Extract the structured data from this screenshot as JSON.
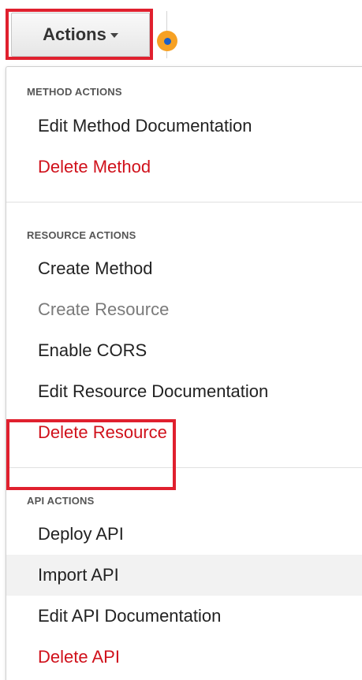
{
  "toolbar": {
    "actions_label": "Actions"
  },
  "menu": {
    "method_header": "METHOD ACTIONS",
    "method_items": [
      {
        "label": "Edit Method Documentation",
        "style": "normal"
      },
      {
        "label": "Delete Method",
        "style": "danger"
      }
    ],
    "resource_header": "RESOURCE ACTIONS",
    "resource_items": [
      {
        "label": "Create Method",
        "style": "normal"
      },
      {
        "label": "Create Resource",
        "style": "disabled"
      },
      {
        "label": "Enable CORS",
        "style": "normal"
      },
      {
        "label": "Edit Resource Documentation",
        "style": "normal"
      },
      {
        "label": "Delete Resource",
        "style": "danger"
      }
    ],
    "api_header": "API ACTIONS",
    "api_items": [
      {
        "label": "Deploy API",
        "style": "normal"
      },
      {
        "label": "Import API",
        "style": "hover"
      },
      {
        "label": "Edit API Documentation",
        "style": "normal"
      },
      {
        "label": "Delete API",
        "style": "danger"
      }
    ]
  },
  "colors": {
    "danger": "#d0111b",
    "highlight": "#e0202e",
    "indicator": "#f6a124",
    "indicator_center": "#1c5fc6"
  },
  "icons": [
    "caret-down-icon",
    "status-dot-icon"
  ]
}
